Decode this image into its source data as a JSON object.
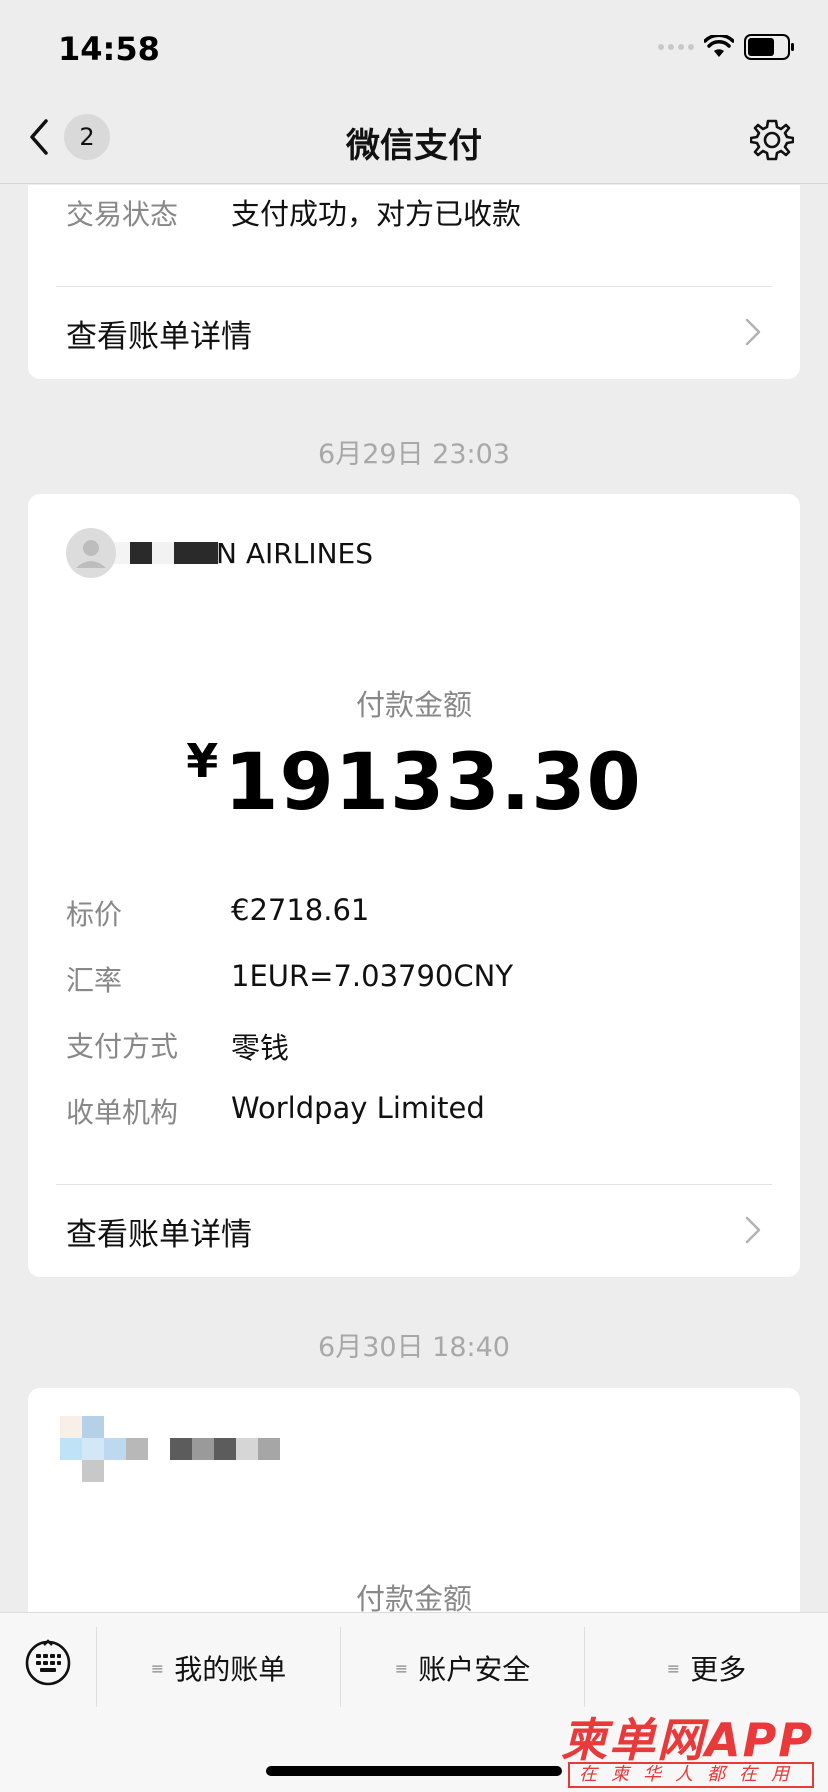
{
  "status_bar": {
    "time": "14:58"
  },
  "nav": {
    "back_count": "2",
    "title": "微信支付"
  },
  "card1": {
    "status_label": "交易状态",
    "status_value": "支付成功，对方已收款",
    "details_link": "查看账单详情"
  },
  "date1": "6月29日 23:03",
  "card2": {
    "merchant_suffix": "N AIRLINES",
    "pay_label": "付款金额",
    "currency_symbol": "¥",
    "amount": "19133.30",
    "rows": [
      {
        "label": "标价",
        "value": "€2718.61"
      },
      {
        "label": "汇率",
        "value": "1EUR=7.03790CNY"
      },
      {
        "label": "支付方式",
        "value": "零钱"
      },
      {
        "label": "收单机构",
        "value": "Worldpay Limited"
      }
    ],
    "details_link": "查看账单详情"
  },
  "date2": "6月30日 18:40",
  "card3": {
    "pay_label": "付款金额"
  },
  "bottom_menu": {
    "my_bills": "我的账单",
    "account_security": "账户安全",
    "more": "更多"
  },
  "watermark": {
    "main": "柬单网APP",
    "sub": "在柬华人都在用"
  },
  "colors": {
    "background": "#ededed",
    "card": "#ffffff",
    "watermark": "#e83a3a"
  }
}
